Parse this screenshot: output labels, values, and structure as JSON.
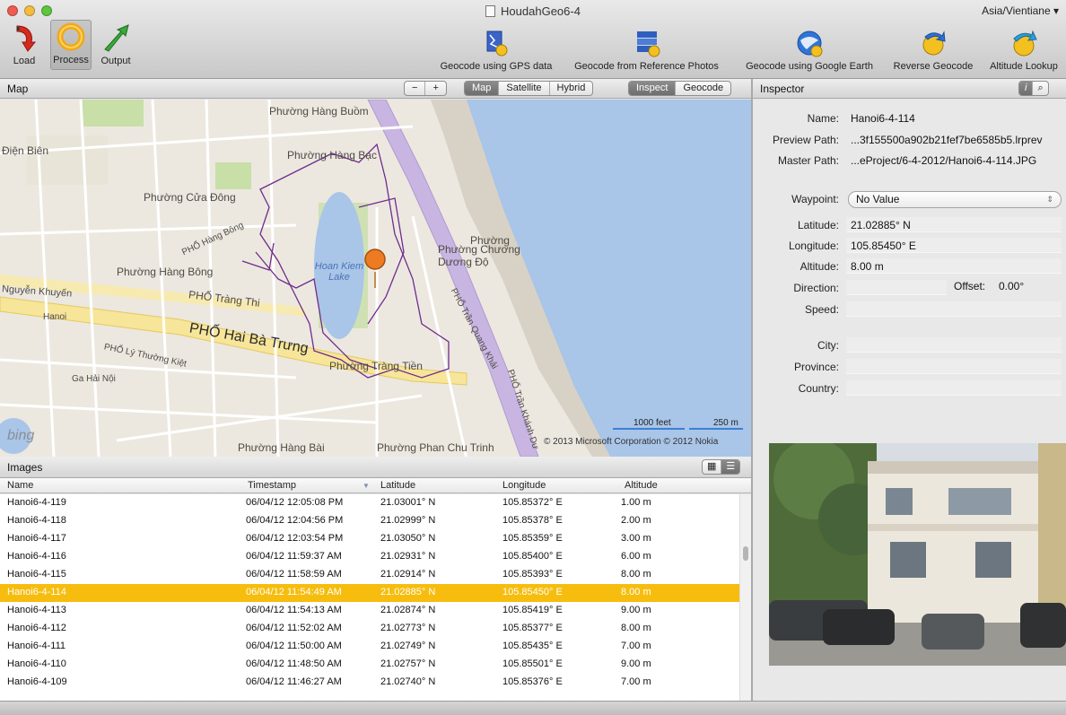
{
  "window": {
    "title": "HoudahGeo6-4",
    "timezone": "Asia/Vientiane"
  },
  "toolbar": {
    "left": [
      {
        "label": "Load",
        "icon": "load-icon"
      },
      {
        "label": "Process",
        "icon": "process-icon"
      },
      {
        "label": "Output",
        "icon": "output-icon"
      }
    ],
    "right": [
      {
        "label": "Geocode using GPS data",
        "icon": "gps-track-icon"
      },
      {
        "label": "Geocode from Reference Photos",
        "icon": "reference-photos-icon"
      },
      {
        "label": "Geocode using Google Earth",
        "icon": "google-earth-icon"
      },
      {
        "label": "Reverse Geocode",
        "icon": "reverse-geocode-icon"
      },
      {
        "label": "Altitude Lookup",
        "icon": "altitude-lookup-icon"
      }
    ]
  },
  "map_pane": {
    "title": "Map",
    "zoom_out": "−",
    "zoom_in": "+",
    "map_types": [
      "Map",
      "Satellite",
      "Hybrid"
    ],
    "selected_map_type": "Map",
    "modes": [
      "Inspect",
      "Geocode"
    ],
    "selected_mode": "Inspect",
    "scale_feet": "1000 feet",
    "scale_m": "250 m",
    "copyright": "© 2013 Microsoft Corporation   © 2012 Nokia",
    "brand": "bing",
    "labels": {
      "l1": "Phường Hàng Buồm",
      "l2": "Phường Hàng Bạc",
      "l3": "Phường Cửa Đông",
      "l4": "Phường Hàng Bông",
      "l5": "Phường Chương Dương Độ",
      "l6": "PHỐ Hai Bà Trưng",
      "l7": "PHỐ Tràng Thi",
      "l8": "Phường Tràng Tiền",
      "l9": "Phường Hàng Bài",
      "l10": "Phường Phan Chu Trinh",
      "l11": "Hoan Kiem Lake",
      "l12": "Điện Biên",
      "l13": "Nguyễn Khuyến",
      "l14": "Ga Hải Nội",
      "l15": "Hanoi",
      "l16": "PHỐ Trần Quang Khải",
      "l17": "PHỐ Trần Khánh Dư",
      "l18": "PHỐ Lý Thường Kiệt",
      "l19": "Phường",
      "l20": "PHỐ Hàng Bông"
    }
  },
  "images_pane": {
    "title": "Images",
    "columns": [
      "Name",
      "Timestamp",
      "Latitude",
      "Longitude",
      "Altitude"
    ],
    "selected_row": 5,
    "rows": [
      {
        "name": "Hanoi6-4-119",
        "timestamp": "06/04/12 12:05:08 PM",
        "latitude": "21.03001° N",
        "longitude": "105.85372° E",
        "altitude": "1.00 m"
      },
      {
        "name": "Hanoi6-4-118",
        "timestamp": "06/04/12 12:04:56 PM",
        "latitude": "21.02999° N",
        "longitude": "105.85378° E",
        "altitude": "2.00 m"
      },
      {
        "name": "Hanoi6-4-117",
        "timestamp": "06/04/12 12:03:54 PM",
        "latitude": "21.03050° N",
        "longitude": "105.85359° E",
        "altitude": "3.00 m"
      },
      {
        "name": "Hanoi6-4-116",
        "timestamp": "06/04/12 11:59:37 AM",
        "latitude": "21.02931° N",
        "longitude": "105.85400° E",
        "altitude": "6.00 m"
      },
      {
        "name": "Hanoi6-4-115",
        "timestamp": "06/04/12 11:58:59 AM",
        "latitude": "21.02914° N",
        "longitude": "105.85393° E",
        "altitude": "8.00 m"
      },
      {
        "name": "Hanoi6-4-114",
        "timestamp": "06/04/12 11:54:49 AM",
        "latitude": "21.02885° N",
        "longitude": "105.85450° E",
        "altitude": "8.00 m"
      },
      {
        "name": "Hanoi6-4-113",
        "timestamp": "06/04/12 11:54:13 AM",
        "latitude": "21.02874° N",
        "longitude": "105.85419° E",
        "altitude": "9.00 m"
      },
      {
        "name": "Hanoi6-4-112",
        "timestamp": "06/04/12 11:52:02 AM",
        "latitude": "21.02773° N",
        "longitude": "105.85377° E",
        "altitude": "8.00 m"
      },
      {
        "name": "Hanoi6-4-111",
        "timestamp": "06/04/12 11:50:00 AM",
        "latitude": "21.02749° N",
        "longitude": "105.85435° E",
        "altitude": "7.00 m"
      },
      {
        "name": "Hanoi6-4-110",
        "timestamp": "06/04/12 11:48:50 AM",
        "latitude": "21.02757° N",
        "longitude": "105.85501° E",
        "altitude": "9.00 m"
      },
      {
        "name": "Hanoi6-4-109",
        "timestamp": "06/04/12 11:46:27 AM",
        "latitude": "21.02740° N",
        "longitude": "105.85376° E",
        "altitude": "7.00 m"
      }
    ]
  },
  "inspector": {
    "title": "Inspector",
    "fields": {
      "name_label": "Name:",
      "name": "Hanoi6-4-114",
      "preview_label": "Preview Path:",
      "preview": "...3f155500a902b21fef7be6585b5.lrprev",
      "master_label": "Master Path:",
      "master": "...eProject/6-4-2012/Hanoi6-4-114.JPG",
      "waypoint_label": "Waypoint:",
      "waypoint": "No Value",
      "latitude_label": "Latitude:",
      "latitude": "21.02885° N",
      "longitude_label": "Longitude:",
      "longitude": "105.85450° E",
      "altitude_label": "Altitude:",
      "altitude": "8.00 m",
      "direction_label": "Direction:",
      "offset_label": "Offset:",
      "offset": "0.00°",
      "speed_label": "Speed:",
      "city_label": "City:",
      "province_label": "Province:",
      "country_label": "Country:"
    }
  }
}
